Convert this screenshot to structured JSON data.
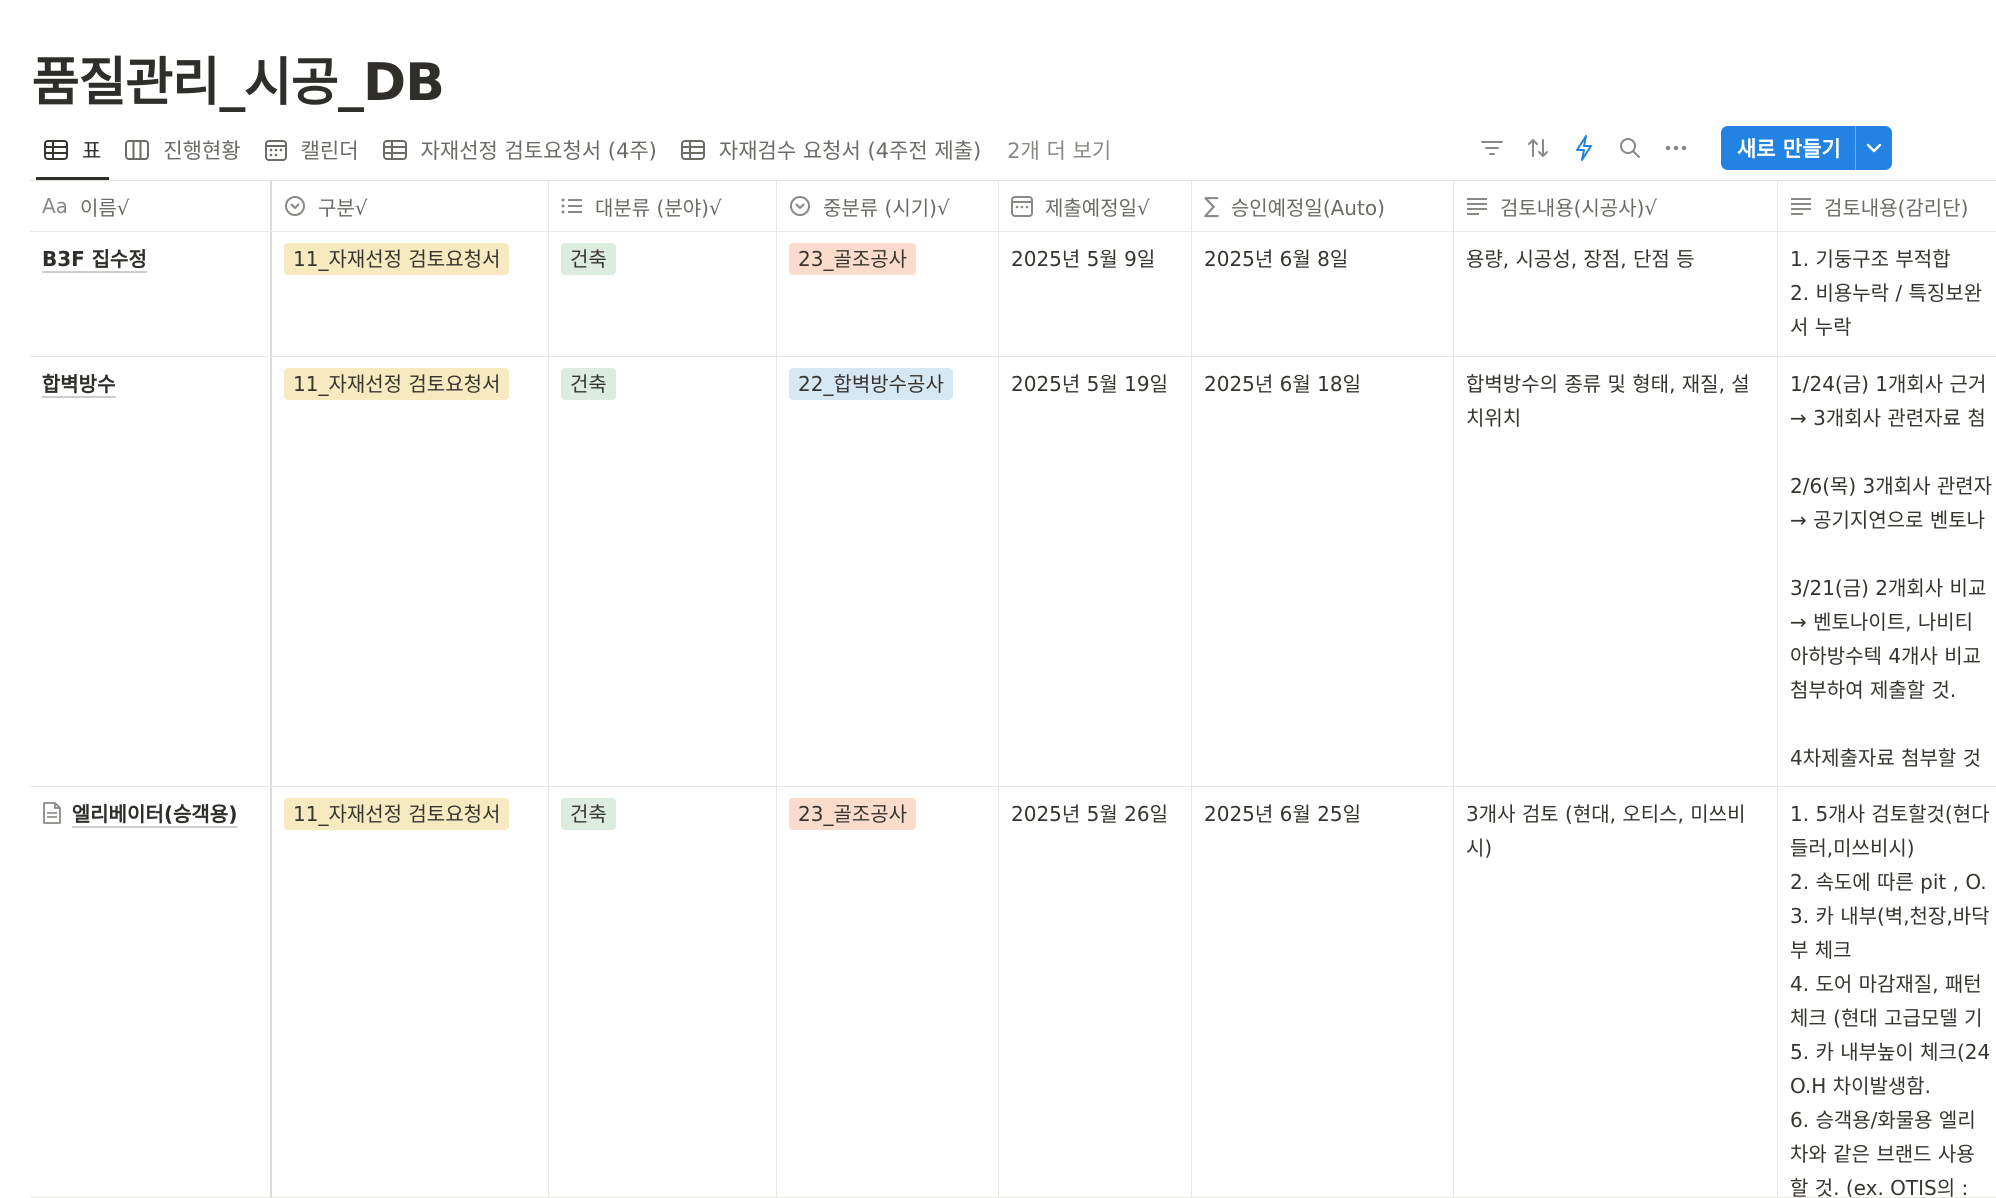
{
  "page": {
    "title": "품질관리_시공_DB"
  },
  "views": {
    "tabs": [
      {
        "label": "표",
        "icon": "table-icon"
      },
      {
        "label": "진행현황",
        "icon": "board-icon"
      },
      {
        "label": "캘린더",
        "icon": "calendar-icon"
      },
      {
        "label": "자재선정 검토요청서 (4주)",
        "icon": "table-icon"
      },
      {
        "label": "자재검수 요청서 (4주전 제출)",
        "icon": "table-icon"
      }
    ],
    "more_label": "2개 더 보기"
  },
  "toolbar": {
    "icons": [
      "filter-icon",
      "sort-icon",
      "automation-icon",
      "search-icon",
      "more-icon"
    ],
    "new_button_label": "새로 만들기"
  },
  "colors": {
    "accent": "#2383e2",
    "tag_yellow_bg": "#f8eac0",
    "tag_green_bg": "#dcecdf",
    "tag_orange_bg": "#f9dccb",
    "tag_blue_bg": "#d5e8f4"
  },
  "table": {
    "columns": [
      {
        "label": "이름√",
        "icon": "Aa"
      },
      {
        "label": "구분√",
        "icon": "select-icon"
      },
      {
        "label": "대분류 (분야)√",
        "icon": "list-icon"
      },
      {
        "label": "중분류 (시기)√",
        "icon": "select-icon"
      },
      {
        "label": "제출예정일√",
        "icon": "calendar-icon"
      },
      {
        "label": "승인예정일(Auto)",
        "icon": "formula-icon"
      },
      {
        "label": "검토내용(시공사)√",
        "icon": "text-icon"
      },
      {
        "label": "검토내용(감리단)",
        "icon": "text-icon"
      }
    ],
    "rows": [
      {
        "name": "B3F 집수정",
        "has_doc_icon": false,
        "category": "11_자재선정 검토요청서",
        "major": "건축",
        "minor": "23_골조공사",
        "minor_color": "orange",
        "submit_date": "2025년 5월 9일",
        "approve_date": "2025년 6월 8일",
        "review_contractor": "용량, 시공성, 장점, 단점 등",
        "review_supervisor": "1. 기둥구조 부적합\n2. 비용누락 / 특징보완\n서 누락"
      },
      {
        "name": "합벽방수",
        "has_doc_icon": false,
        "category": "11_자재선정 검토요청서",
        "major": "건축",
        "minor": "22_합벽방수공사",
        "minor_color": "blue",
        "submit_date": "2025년 5월 19일",
        "approve_date": "2025년 6월 18일",
        "review_contractor": "합벽방수의 종류 및 형태, 재질, 설치위치",
        "review_supervisor": "1/24(금) 1개회사 근거\n→ 3개회사 관련자료 첨\n\n2/6(목) 3개회사 관련자\n→ 공기지연으로 벤토나\n\n3/21(금) 2개회사 비교\n→ 벤토나이트, 나비티\n아하방수텍 4개사 비교\n첨부하여 제출할 것.\n\n4차제출자료 첨부할 것"
      },
      {
        "name": "엘리베이터(승객용)",
        "has_doc_icon": true,
        "category": "11_자재선정 검토요청서",
        "major": "건축",
        "minor": "23_골조공사",
        "minor_color": "orange",
        "submit_date": "2025년 5월 26일",
        "approve_date": "2025년 6월 25일",
        "review_contractor": "3개사 검토 (현대, 오티스, 미쓰비시)",
        "review_supervisor": "1. 5개사 검토할것(현다\n들러,미쓰비시)\n2. 속도에 따른 pit , O.\n3. 카 내부(벽,천장,바닥\n부 체크\n4. 도어 마감재질, 패턴\n체크 (현대 고급모델 기\n5. 카 내부높이 체크(24\nO.H 차이발생함.\n6. 승객용/화물용 엘리\n차와 같은 브랜드 사용\n할 것. (ex. OTIS의 :"
      }
    ]
  }
}
